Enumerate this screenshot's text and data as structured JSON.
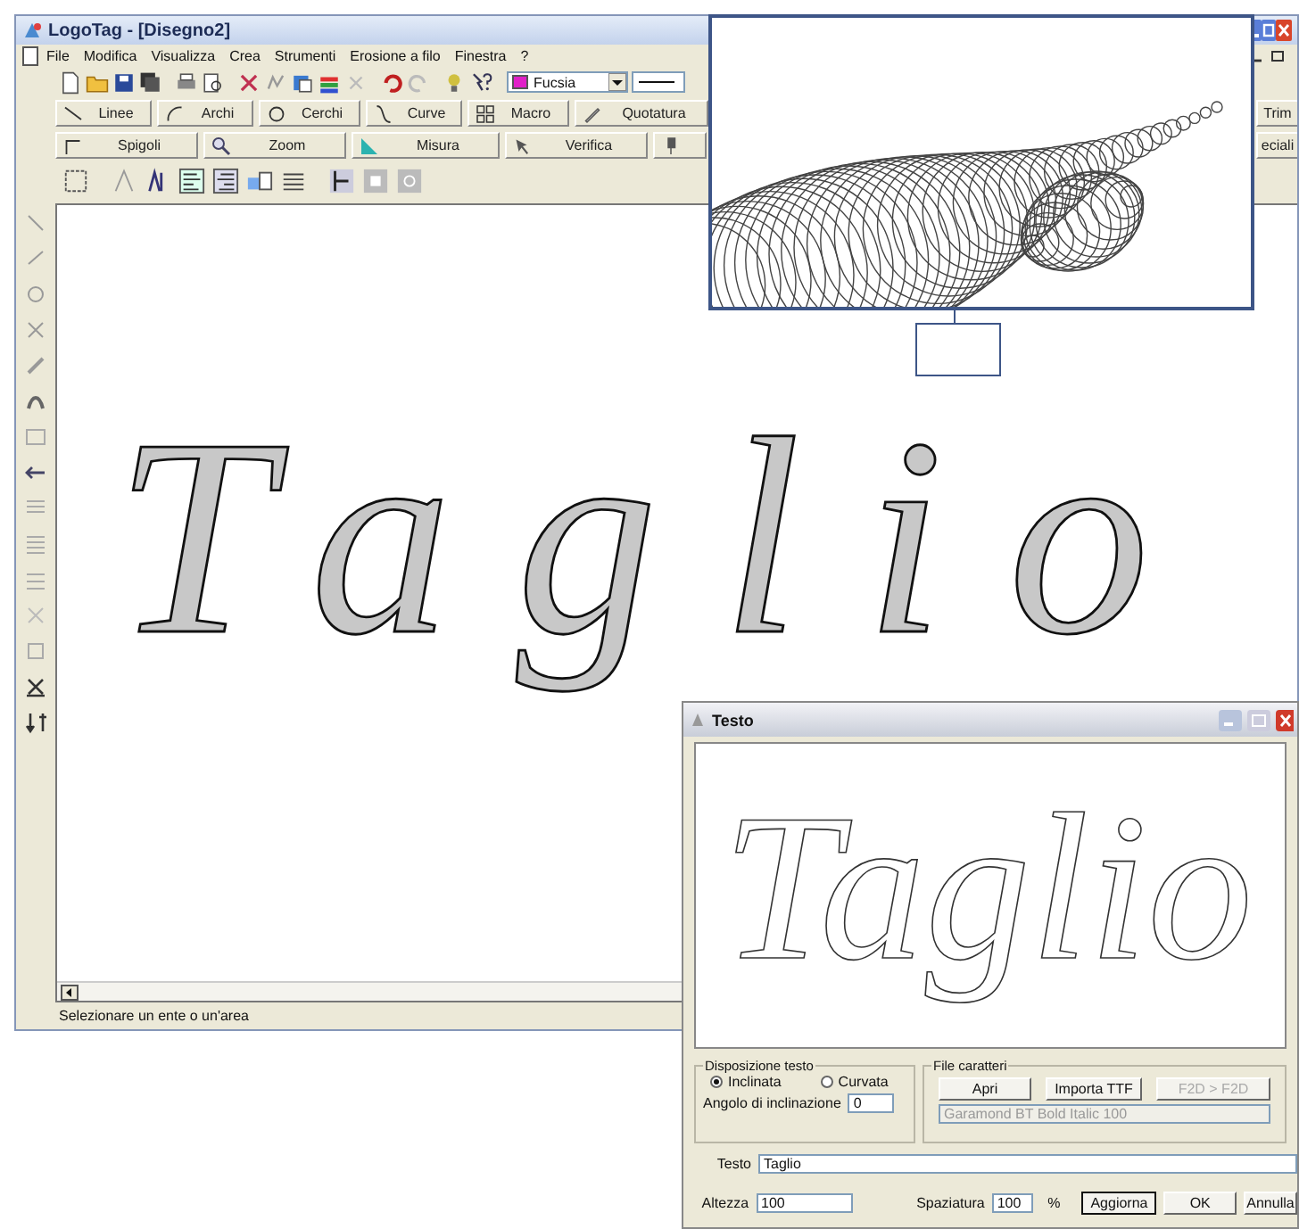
{
  "window": {
    "title": "LogoTag - [Disegno2]"
  },
  "menu": [
    "File",
    "Modifica",
    "Visualizza",
    "Crea",
    "Strumenti",
    "Erosione a filo",
    "Finestra",
    "?"
  ],
  "toolbar": {
    "color_dropdown": "Fucsia"
  },
  "tool_rows": [
    [
      {
        "kind": "line",
        "label": "Linee"
      },
      {
        "kind": "arc",
        "label": "Archi"
      },
      {
        "kind": "circle",
        "label": "Cerchi"
      },
      {
        "kind": "curve",
        "label": "Curve"
      },
      {
        "kind": "macro",
        "label": "Macro"
      },
      {
        "kind": "dimension",
        "label": "Quotatura"
      },
      {
        "kind": "trim",
        "label": "Trim"
      }
    ],
    [
      {
        "kind": "corner",
        "label": "Spigoli"
      },
      {
        "kind": "zoom",
        "label": "Zoom"
      },
      {
        "kind": "measure",
        "label": "Misura"
      },
      {
        "kind": "verify",
        "label": "Verifica"
      },
      {
        "kind": "pin"
      },
      {
        "kind": "special",
        "label": "eciali"
      }
    ]
  ],
  "canvas": {
    "text": "Taglio"
  },
  "status_bar": "Selezionare un ente o un'area",
  "dialog": {
    "title": "Testo",
    "preview_text": "Taglio",
    "layout_group": {
      "title": "Disposizione testo",
      "options": [
        {
          "label": "Inclinata",
          "selected": true
        },
        {
          "label": "Curvata",
          "selected": false
        }
      ],
      "angle_label": "Angolo di inclinazione",
      "angle_value": "0"
    },
    "font_group": {
      "title": "File caratteri",
      "buttons": [
        {
          "label": "Apri",
          "disabled": false
        },
        {
          "label": "Importa TTF",
          "disabled": false
        },
        {
          "label": "F2D > F2D",
          "disabled": true
        }
      ],
      "font_file": "Garamond BT Bold Italic 100"
    },
    "text_label": "Testo",
    "text_value": "Taglio",
    "height_label": "Altezza",
    "height_value": "100",
    "spacing_label": "Spaziatura",
    "spacing_value": "100",
    "spacing_unit": "%",
    "buttons": [
      "Aggiorna",
      "OK",
      "Annulla"
    ]
  }
}
